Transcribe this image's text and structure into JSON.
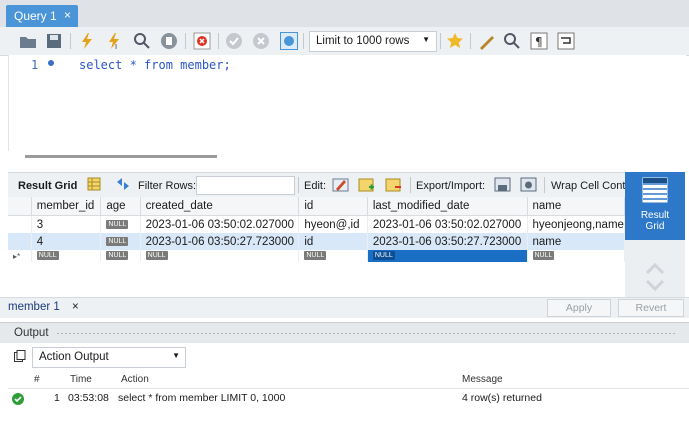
{
  "tab": {
    "title": "Query 1",
    "close": "×"
  },
  "toolbar": {
    "icons": [
      "open-folder-icon",
      "save-icon",
      "execute-icon",
      "execute-current-icon",
      "explain-icon",
      "stop-icon",
      "toggle-error-icon",
      "commit-icon",
      "rollback-icon",
      "autocommit-icon",
      "bookmark-icon",
      "beautify-icon",
      "find-icon",
      "invisible-chars-icon",
      "wrap-icon"
    ],
    "limit_select": "Limit to 1000 rows"
  },
  "editor": {
    "line_number": "1",
    "sql": "select * from member;"
  },
  "result_toolbar": {
    "result_grid": "Result Grid",
    "filter_rows": "Filter Rows:",
    "edit": "Edit:",
    "export_import": "Export/Import:",
    "wrap": "Wrap Cell Conte"
  },
  "grid": {
    "columns": [
      "member_id",
      "age",
      "created_date",
      "id",
      "last_modified_date",
      "name"
    ],
    "null_label": "NULL",
    "new_row_marker": "▸*",
    "rows": [
      [
        "3",
        "NULL",
        "2023-01-06 03:50:02.027000",
        "hyeon@,id",
        "2023-01-06 03:50:02.027000",
        "hyeonjeong,name"
      ],
      [
        "4",
        "NULL",
        "2023-01-06 03:50:27.723000",
        "id",
        "2023-01-06 03:50:27.723000",
        "name"
      ],
      [
        "NULL",
        "NULL",
        "NULL",
        "NULL",
        "NULL",
        "NULL"
      ]
    ]
  },
  "side_panel": {
    "result_grid_label_1": "Result",
    "result_grid_label_2": "Grid"
  },
  "result_tabs": {
    "member_tab": "member 1",
    "close": "×",
    "apply": "Apply",
    "revert": "Revert"
  },
  "output": {
    "title": "Output",
    "select": "Action Output",
    "headers": {
      "num": "#",
      "time": "Time",
      "action": "Action",
      "message": "Message"
    },
    "rows": [
      {
        "num": "1",
        "time": "03:53:08",
        "action": "select * from member LIMIT 0, 1000",
        "message": "4 row(s) returned",
        "status": "ok"
      }
    ]
  },
  "colors": {
    "accent": "#4a95d8",
    "selection": "#1a6fc4",
    "ok": "#2e9d3a"
  }
}
